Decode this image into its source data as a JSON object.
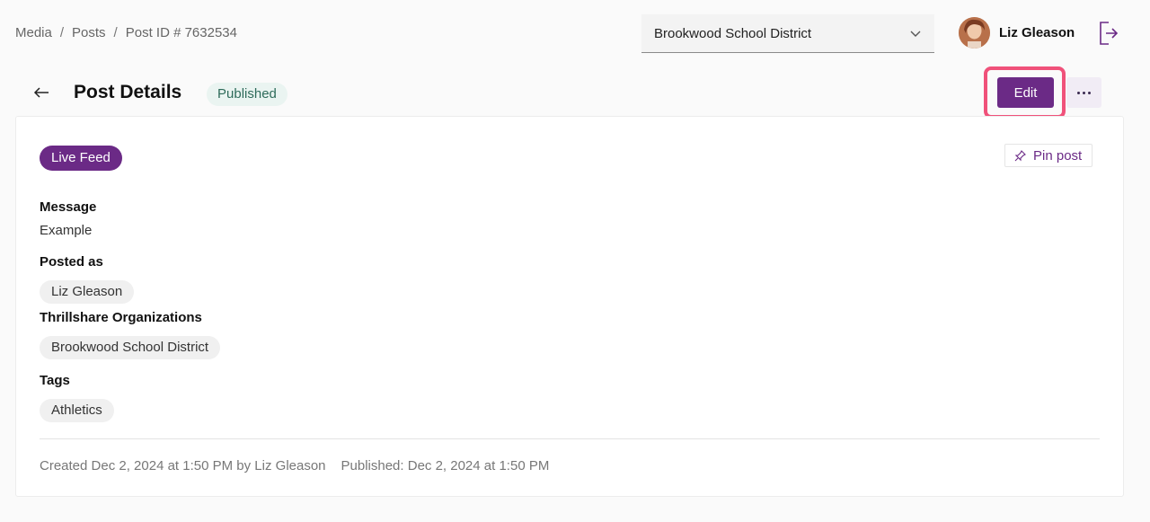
{
  "breadcrumb": {
    "items": [
      "Media",
      "Posts",
      "Post ID # 7632534"
    ],
    "separator": "/"
  },
  "org_select": {
    "value": "Brookwood School District",
    "icon": "chevron-down-icon"
  },
  "user": {
    "name": "Liz Gleason",
    "avatar_icon": "avatar",
    "logout_icon": "logout-icon"
  },
  "header": {
    "title": "Post Details",
    "status": "Published",
    "edit_label": "Edit",
    "more_icon": "more-dots-icon",
    "back_icon": "arrow-left-icon"
  },
  "post": {
    "feed": "Live Feed",
    "pin_label": "Pin post",
    "pin_icon": "pin-icon",
    "message_label": "Message",
    "message": "Example",
    "posted_as_label": "Posted as",
    "posted_as": "Liz Gleason",
    "orgs_label": "Thrillshare Organizations",
    "orgs": [
      "Brookwood School District"
    ],
    "tags_label": "Tags",
    "tags": [
      "Athletics"
    ],
    "created": "Created Dec 2, 2024 at 1:50 PM by Liz Gleason",
    "published": "Published: Dec 2, 2024 at 1:50 PM"
  },
  "colors": {
    "brand": "#6b2a86",
    "highlight": "#f0517a",
    "status_bg": "#eaf4f1",
    "status_text": "#2e6b5a"
  }
}
